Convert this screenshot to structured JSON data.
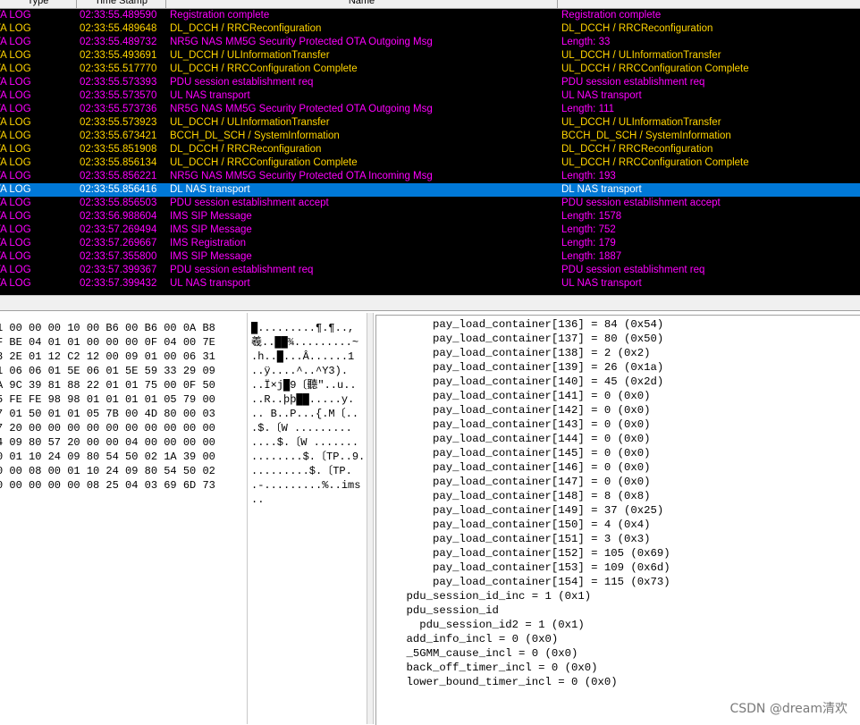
{
  "colors": {
    "magenta": "#ff00ff",
    "yellow": "#ffd400",
    "selected_bg": "#0078d7"
  },
  "log": {
    "columns": [
      "Type",
      "Time Stamp",
      "Name"
    ],
    "rows": [
      {
        "type": "TA LOG",
        "time": "02:33:55.489590",
        "name": "Registration  complete",
        "desc": "Registration  complete",
        "color": "magenta"
      },
      {
        "type": "TA LOG",
        "time": "02:33:55.489648",
        "name": "DL_DCCH  /  RRCReconfiguration",
        "desc": "DL_DCCH  /  RRCReconfiguration",
        "color": "yellow"
      },
      {
        "type": "TA LOG",
        "time": "02:33:55.489732",
        "name": "NR5G  NAS  MM5G  Security  Protected  OTA  Outgoing  Msg",
        "desc": "Length:   33",
        "color": "magenta"
      },
      {
        "type": "TA LOG",
        "time": "02:33:55.493691",
        "name": "UL_DCCH  /  ULInformationTransfer",
        "desc": "UL_DCCH  /  ULInformationTransfer",
        "color": "yellow"
      },
      {
        "type": "TA LOG",
        "time": "02:33:55.517770",
        "name": "UL_DCCH  /  RRCConfiguration  Complete",
        "desc": "UL_DCCH  /  RRCConfiguration  Complete",
        "color": "yellow"
      },
      {
        "type": "TA LOG",
        "time": "02:33:55.573393",
        "name": "PDU  session  establishment  req",
        "desc": "PDU  session  establishment  req",
        "color": "magenta"
      },
      {
        "type": "TA LOG",
        "time": "02:33:55.573570",
        "name": "UL  NAS  transport",
        "desc": "UL  NAS  transport",
        "color": "magenta"
      },
      {
        "type": "TA LOG",
        "time": "02:33:55.573736",
        "name": "NR5G  NAS  MM5G  Security  Protected  OTA  Outgoing  Msg",
        "desc": "Length:   111",
        "color": "magenta"
      },
      {
        "type": "TA LOG",
        "time": "02:33:55.573923",
        "name": "UL_DCCH  /  ULInformationTransfer",
        "desc": "UL_DCCH  /  ULInformationTransfer",
        "color": "yellow"
      },
      {
        "type": "TA LOG",
        "time": "02:33:55.673421",
        "name": "BCCH_DL_SCH  /  SystemInformation",
        "desc": "BCCH_DL_SCH  /  SystemInformation",
        "color": "yellow"
      },
      {
        "type": "TA LOG",
        "time": "02:33:55.851908",
        "name": "DL_DCCH  /  RRCReconfiguration",
        "desc": "DL_DCCH  /  RRCReconfiguration",
        "color": "yellow"
      },
      {
        "type": "TA LOG",
        "time": "02:33:55.856134",
        "name": "UL_DCCH  /  RRCConfiguration  Complete",
        "desc": "UL_DCCH  /  RRCConfiguration  Complete",
        "color": "yellow"
      },
      {
        "type": "TA LOG",
        "time": "02:33:55.856221",
        "name": "NR5G  NAS  MM5G  Security  Protected  OTA  Incoming  Msg",
        "desc": "Length:   193",
        "color": "magenta"
      },
      {
        "type": "TA LOG",
        "time": "02:33:55.856416",
        "name": "DL  NAS  transport",
        "desc": "DL  NAS  transport",
        "color": "magenta",
        "selected": true
      },
      {
        "type": "TA LOG",
        "time": "02:33:55.856503",
        "name": "PDU  session  establishment  accept",
        "desc": "PDU  session  establishment  accept",
        "color": "magenta"
      },
      {
        "type": "TA LOG",
        "time": "02:33:56.988604",
        "name": "IMS  SIP  Message",
        "desc": "Length:  1578",
        "color": "magenta"
      },
      {
        "type": "TA LOG",
        "time": "02:33:57.269494",
        "name": "IMS  SIP  Message",
        "desc": "Length:  752",
        "color": "magenta"
      },
      {
        "type": "TA LOG",
        "time": "02:33:57.269667",
        "name": "IMS  Registration",
        "desc": "Length:  179",
        "color": "magenta"
      },
      {
        "type": "TA LOG",
        "time": "02:33:57.355800",
        "name": "IMS  SIP  Message",
        "desc": "Length:  1887",
        "color": "magenta"
      },
      {
        "type": "TA LOG",
        "time": "02:33:57.399367",
        "name": "PDU  session  establishment  req",
        "desc": "PDU  session  establishment  req",
        "color": "magenta"
      },
      {
        "type": "TA LOG",
        "time": "02:33:57.399432",
        "name": "UL  NAS  transport",
        "desc": "UL  NAS  transport",
        "color": "magenta"
      }
    ]
  },
  "hex": {
    "lines": [
      "1 00 00 00 10 00 B6 00 B6 00 0A B8",
      "F BE 04 01 01 00 00 00 0F 04 00 7E",
      "8 2E 01 12 C2 12 00 09 01 00 06 31",
      "1 06 06 01 5E 06 01 5E 59 33 29 09",
      "A 9C 39 81 88 22 01 01 75 00 0F 50",
      "5 FE FE 98 98 01 01 01 01 05 79 00",
      "7 01 50 01 01 05 7B 00 4D 80 00 03",
      "7 20 00 00 00 00 00 00 00 00 00 00",
      "4 09 80 57 20 00 00 04 00 00 00 00",
      "0 01 10 24 09 80 54 50 02 1A 39 00",
      "0 00 08 00 01 10 24 09 80 54 50 02",
      "0 00 00 00 00 08 25 04 03 69 6D 73"
    ],
    "ascii": [
      "█.........¶.¶..,",
      "羲..██¾.........~",
      ".h..█...Â......1",
      "..ÿ....^..^Y3).",
      "..Ï×j█9〔聽\"..u..",
      "..R..þþ██.....y.",
      ".. B..P...{.M〔..",
      ".$.〔W .........",
      "....$.〔W .......",
      "........$.〔TP..9.",
      ".........$.〔TP.",
      ".-.........%..ims",
      ".."
    ]
  },
  "tree": {
    "lines": [
      "        pay_load_container[136] = 84 (0x54)",
      "        pay_load_container[137] = 80 (0x50)",
      "        pay_load_container[138] = 2 (0x2)",
      "        pay_load_container[139] = 26 (0x1a)",
      "        pay_load_container[140] = 45 (0x2d)",
      "        pay_load_container[141] = 0 (0x0)",
      "        pay_load_container[142] = 0 (0x0)",
      "        pay_load_container[143] = 0 (0x0)",
      "        pay_load_container[144] = 0 (0x0)",
      "        pay_load_container[145] = 0 (0x0)",
      "        pay_load_container[146] = 0 (0x0)",
      "        pay_load_container[147] = 0 (0x0)",
      "        pay_load_container[148] = 8 (0x8)",
      "        pay_load_container[149] = 37 (0x25)",
      "        pay_load_container[150] = 4 (0x4)",
      "        pay_load_container[151] = 3 (0x3)",
      "        pay_load_container[152] = 105 (0x69)",
      "        pay_load_container[153] = 109 (0x6d)",
      "        pay_load_container[154] = 115 (0x73)",
      "    pdu_session_id_inc = 1 (0x1)",
      "    pdu_session_id",
      "      pdu_session_id2 = 1 (0x1)",
      "    add_info_incl = 0 (0x0)",
      "    _5GMM_cause_incl = 0 (0x0)",
      "    back_off_timer_incl = 0 (0x0)",
      "    lower_bound_timer_incl = 0 (0x0)"
    ]
  },
  "watermark": "CSDN @dream清欢"
}
